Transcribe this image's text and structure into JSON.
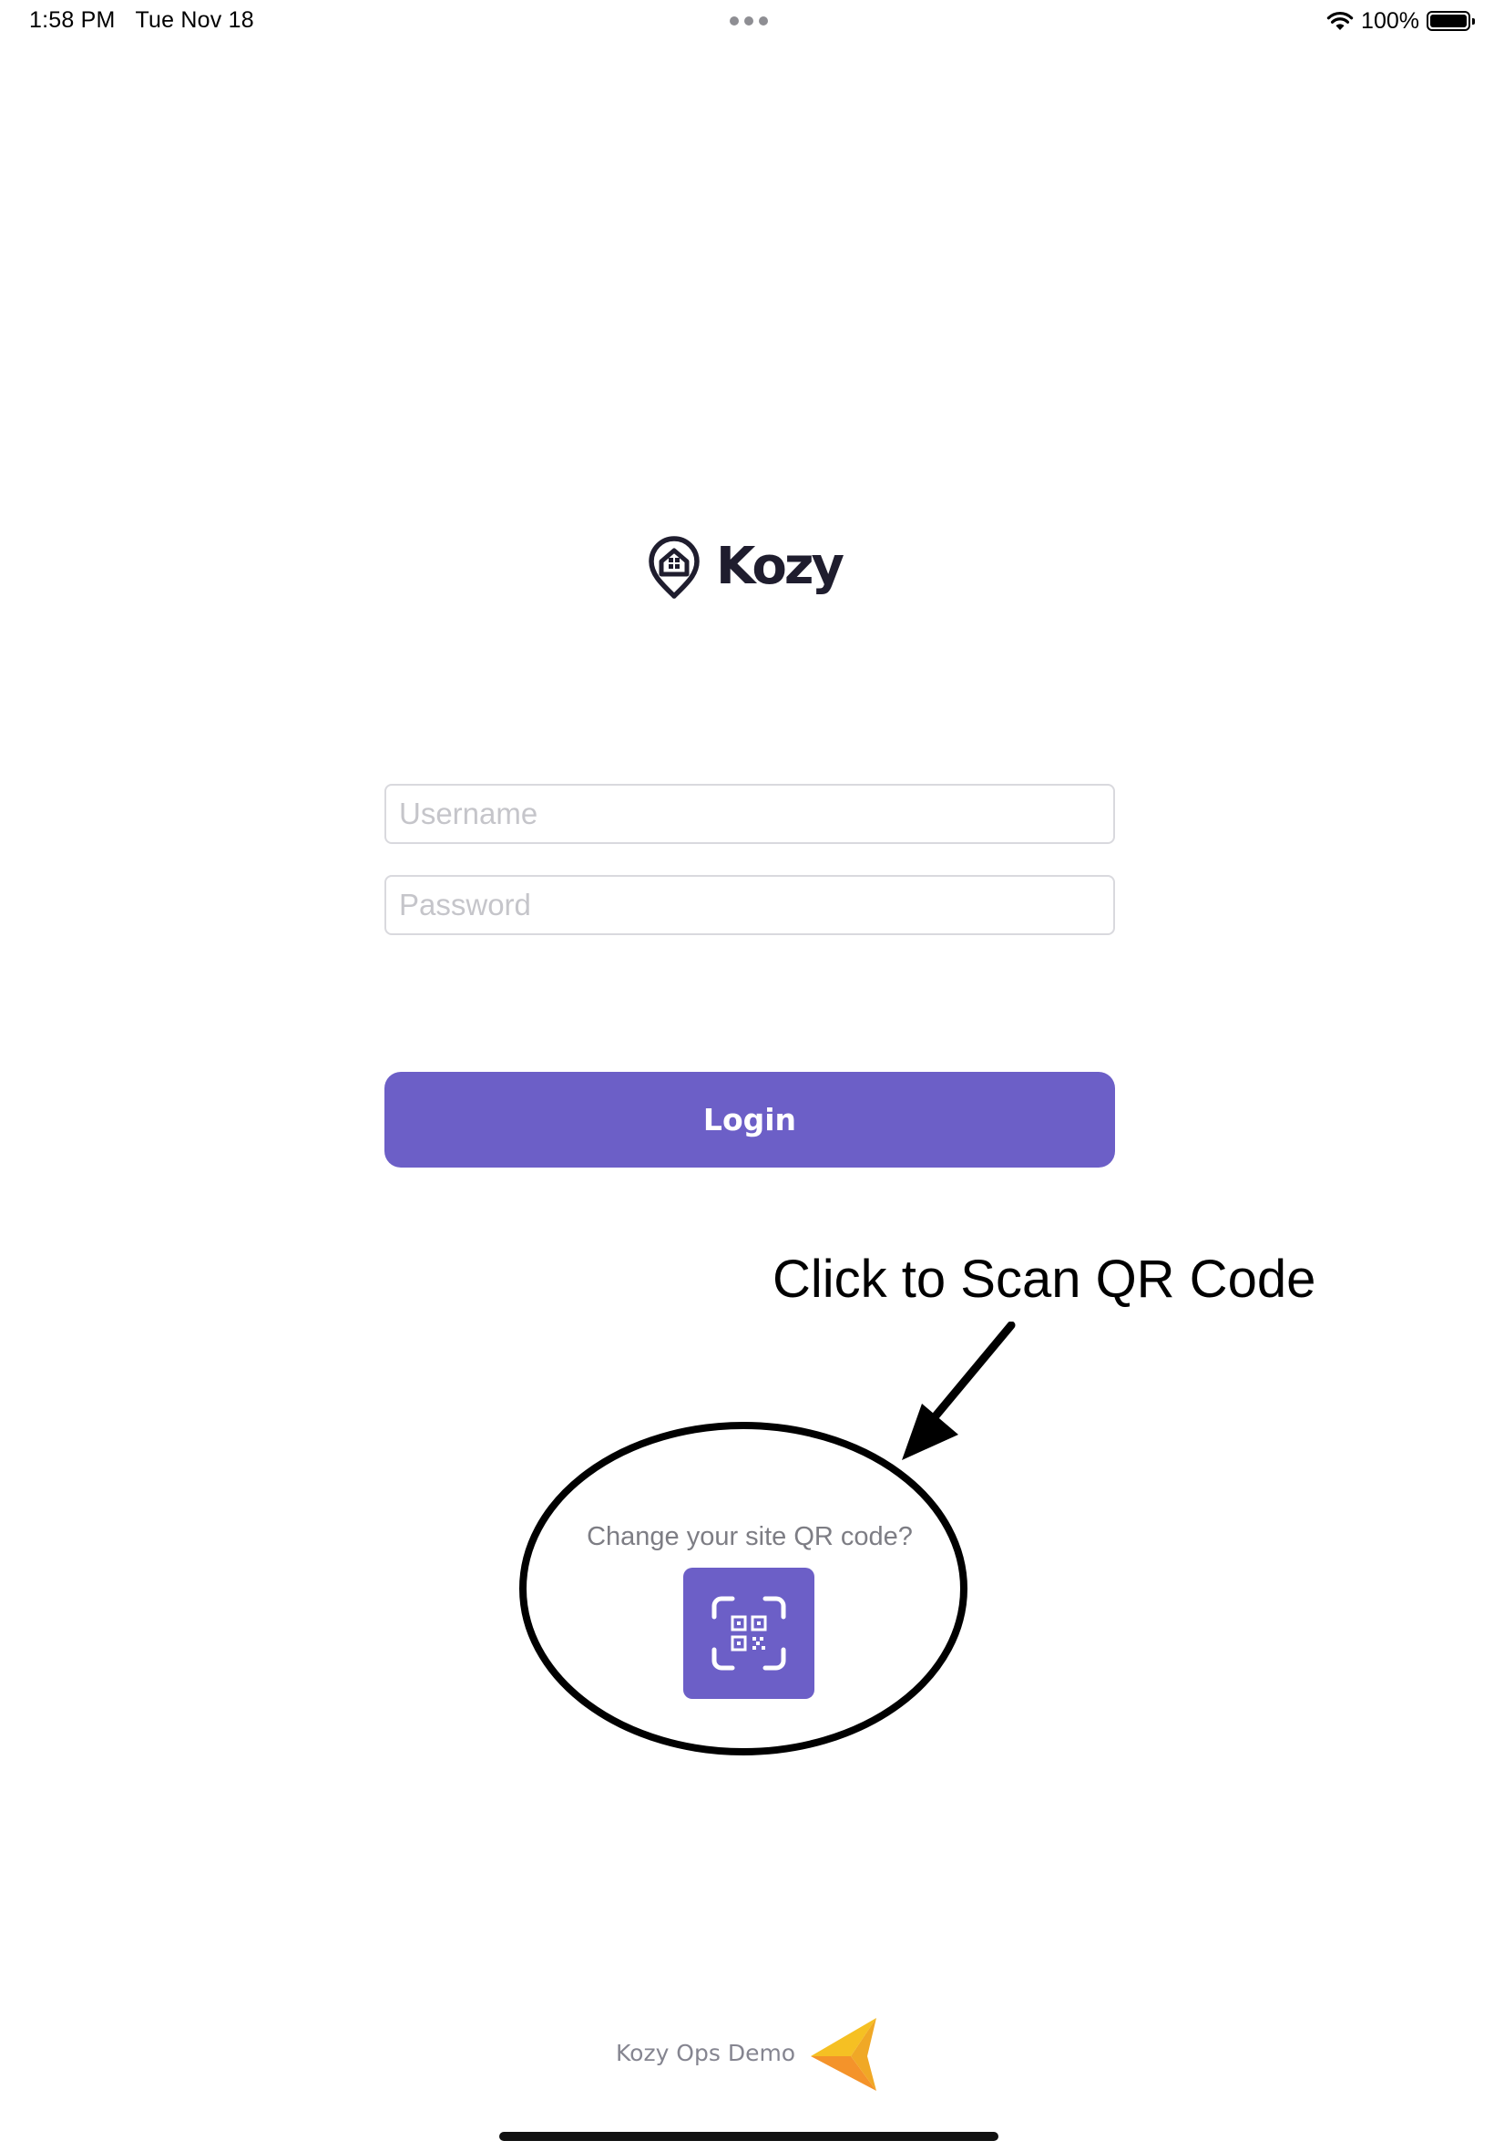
{
  "status_bar": {
    "time": "1:58 PM",
    "date": "Tue Nov 18",
    "battery_percent": "100%",
    "battery_level": 1.0,
    "icons": [
      "wifi-icon",
      "battery-icon",
      "more-dots-icon"
    ]
  },
  "logo": {
    "text": "Kozy",
    "icon": "location-pin-house-icon",
    "color": "#1f1d2e"
  },
  "login_form": {
    "username_placeholder": "Username",
    "username_value": "",
    "password_placeholder": "Password",
    "password_value": "",
    "login_label": "Login"
  },
  "annotation": {
    "text": "Click to Scan QR Code"
  },
  "qr_section": {
    "prompt": "Change your site QR code?",
    "button_icon": "qr-scan-icon"
  },
  "footer": {
    "label": "Kozy Ops Demo",
    "icon": "paper-plane-icon"
  },
  "colors": {
    "accent": "#6c5fc7",
    "placeholder": "#c5c5ca",
    "muted_text": "#7d7d84",
    "footer_icon_yellow": "#f5c023",
    "footer_icon_orange": "#f4932a"
  }
}
